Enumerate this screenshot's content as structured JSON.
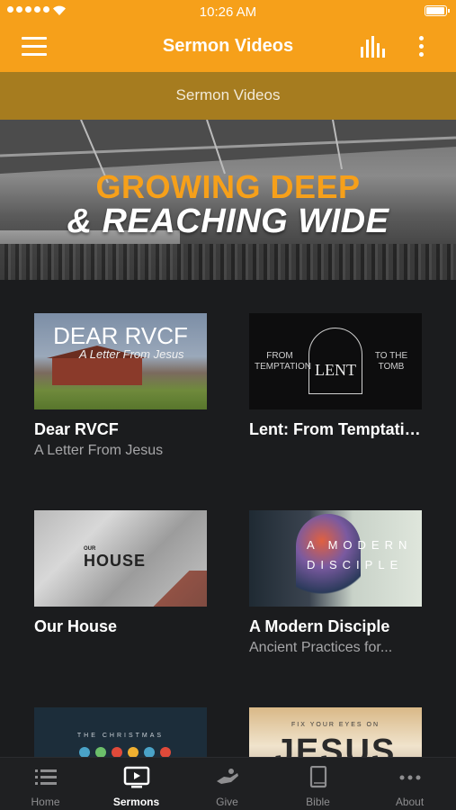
{
  "status_bar": {
    "time": "10:26 AM",
    "battery_level": 1.0
  },
  "nav_bar": {
    "title": "Sermon Videos",
    "menu_icon": "hamburger-menu-icon",
    "audio_icon": "audio-levels-icon",
    "more_icon": "more-vertical-icon"
  },
  "section_header": {
    "title": "Sermon Videos"
  },
  "banner": {
    "line1": "GROWING DEEP",
    "line2": "& REACHING WIDE"
  },
  "series": [
    {
      "title": "Dear RVCF",
      "subtitle": "A Letter From Jesus",
      "thumb_line1": "DEAR RVCF",
      "thumb_line2": "A Letter From Jesus"
    },
    {
      "title": "Lent: From Temptation to th...",
      "subtitle": "",
      "thumb_from": "FROM TEMPTATION",
      "thumb_lent": "LENT",
      "thumb_tomb": "TO THE TOMB"
    },
    {
      "title": "Our House",
      "subtitle": "",
      "thumb_our": "OUR",
      "thumb_house": "HOUSE"
    },
    {
      "title": "A Modern Disciple",
      "subtitle": "Ancient Practices for...",
      "thumb_text": "A MODERN DISCIPLE"
    },
    {
      "title": "",
      "subtitle": "",
      "thumb_text": "THE CHRISTMAS"
    },
    {
      "title": "",
      "subtitle": "",
      "thumb_small": "FIX YOUR EYES ON",
      "thumb_big": "JESUS"
    }
  ],
  "tabs": [
    {
      "label": "Home",
      "icon": "list-icon",
      "active": false
    },
    {
      "label": "Sermons",
      "icon": "tv-play-icon",
      "active": true
    },
    {
      "label": "Give",
      "icon": "giving-hand-icon",
      "active": false
    },
    {
      "label": "Bible",
      "icon": "book-icon",
      "active": false
    },
    {
      "label": "About",
      "icon": "ellipsis-icon",
      "active": false
    }
  ],
  "colors": {
    "accent": "#f6a01a",
    "section_header": "#a67c1f",
    "background": "#1b1c1e",
    "tab_bar": "#1f2022"
  }
}
